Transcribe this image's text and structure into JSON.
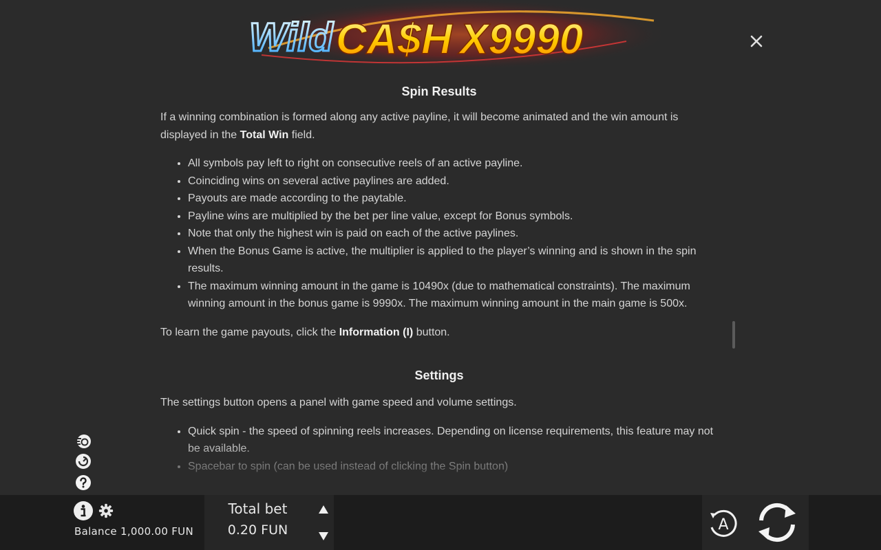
{
  "logo": {
    "word1": "Wild",
    "word2": "CA$H",
    "word3": "X9990"
  },
  "rules": {
    "spin_results_title": "Spin Results",
    "intro_before": "If a winning combination is formed along any active payline, it will become animated and the win amount is displayed in the ",
    "intro_bold": "Total Win",
    "intro_after": " field.",
    "bullets": [
      "All symbols pay left to right on consecutive reels of an active payline.",
      "Coinciding wins on several active paylines are added.",
      "Payouts are made according to the paytable.",
      "Payline wins are multiplied by the bet per line value, except for Bonus symbols.",
      "Note that only the highest win is paid on each of the active paylines.",
      "When the Bonus Game is active, the multiplier is applied to the player’s winning and is shown in the spin results.",
      "The maximum winning amount in the game is 10490x (due to mathematical constraints). The maximum winning amount in the bonus game is 9990x. The maximum winning amount in the main game is 500x."
    ],
    "payouts_before": "To learn the game payouts, click the ",
    "payouts_bold": "Information (I)",
    "payouts_after": " button.",
    "settings_title": "Settings",
    "settings_intro": "The settings button opens a panel with game speed and volume settings.",
    "settings_bullets": [
      "Quick spin - the speed of spinning reels increases. Depending on license requirements, this feature may not be available.",
      "Spacebar to spin (can be used instead of clicking the Spin button)"
    ]
  },
  "bottom": {
    "balance": "Balance 1,000.00 FUN",
    "total_bet_label": "Total bet",
    "total_bet_value": "0.20 FUN",
    "autoplay_letter": "A"
  },
  "colors": {
    "background": "#2b2b2b",
    "bar": "#1c1c1c",
    "panel": "#262626",
    "text": "#d4d4d4"
  }
}
